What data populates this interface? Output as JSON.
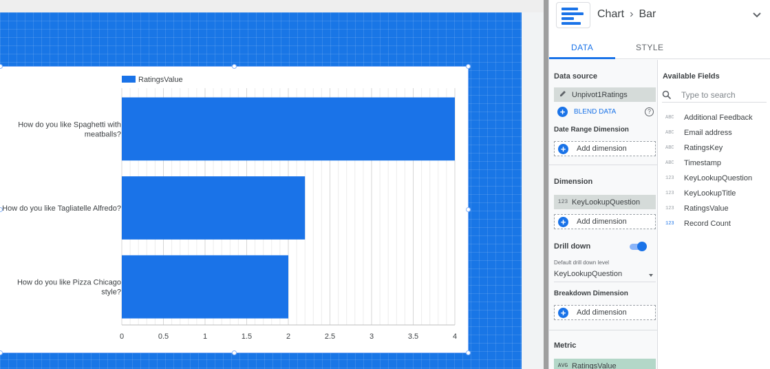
{
  "header": {
    "crumb_root": "Chart",
    "crumb_leaf": "Bar"
  },
  "tabs": [
    {
      "label": "DATA"
    },
    {
      "label": "STYLE"
    }
  ],
  "data_source": {
    "title": "Data source",
    "name": "Unpivot1Ratings",
    "blend_label": "BLEND DATA"
  },
  "date_range": {
    "title": "Date Range Dimension",
    "add_label": "Add dimension"
  },
  "dimension": {
    "title": "Dimension",
    "chip_type": "123",
    "chip_label": "KeyLookupQuestion",
    "add_label": "Add dimension"
  },
  "drill_down": {
    "title": "Drill down",
    "enabled": true,
    "level_label": "Default drill down level",
    "level_value": "KeyLookupQuestion"
  },
  "breakdown": {
    "title": "Breakdown Dimension",
    "add_label": "Add dimension"
  },
  "metric": {
    "title": "Metric",
    "chip_type": "AVG",
    "chip_label": "RatingsValue"
  },
  "available_fields": {
    "title": "Available Fields",
    "search_placeholder": "Type to search",
    "items": [
      {
        "type": "ABC",
        "label": "Additional Feedback"
      },
      {
        "type": "ABC",
        "label": "Email address"
      },
      {
        "type": "ABC",
        "label": "RatingsKey"
      },
      {
        "type": "ABC",
        "label": "Timestamp"
      },
      {
        "type": "123",
        "label": "KeyLookupQuestion"
      },
      {
        "type": "123",
        "label": "KeyLookupTitle"
      },
      {
        "type": "123",
        "label": "RatingsValue"
      },
      {
        "type": "123",
        "label": "Record Count"
      }
    ]
  },
  "colors": {
    "accent": "#1a73e8",
    "bar": "#1a73e8",
    "canvas_blue": "#1976e6"
  },
  "chart_data": {
    "type": "bar",
    "orientation": "horizontal",
    "categories": [
      "How do you like Spaghetti with meatballs?",
      "How do you like Tagliatelle Alfredo?",
      "How do you like Pizza Chicago style?"
    ],
    "category_lines": [
      [
        "How do you like Spaghetti with",
        "meatballs?"
      ],
      [
        "How do you like Tagliatelle Alfredo?"
      ],
      [
        "How do you like Pizza Chicago",
        "style?"
      ]
    ],
    "series": [
      {
        "name": "RatingsValue",
        "values": [
          4,
          2.2,
          2
        ]
      }
    ],
    "xlim": [
      0,
      4
    ],
    "ticks": [
      "0",
      "0.5",
      "1",
      "1.5",
      "2",
      "2.5",
      "3",
      "3.5",
      "4"
    ],
    "grid": true,
    "legend": "top-left"
  }
}
